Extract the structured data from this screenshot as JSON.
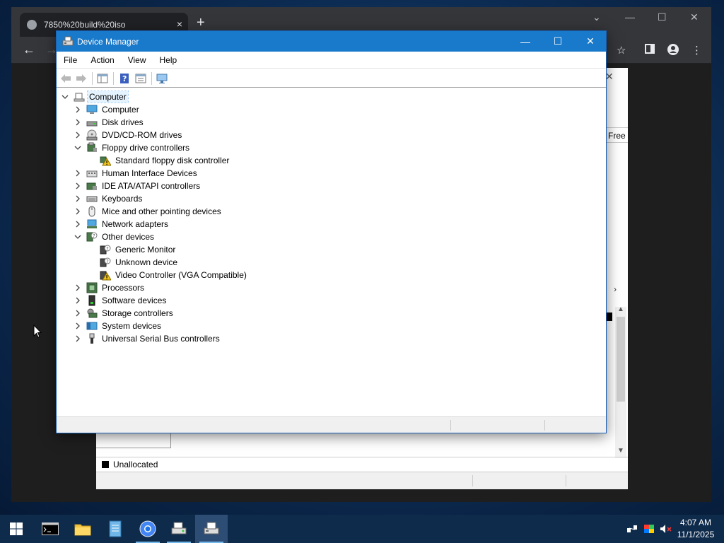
{
  "browser": {
    "tab_title": "7850%20build%20iso",
    "window_controls": [
      "minimize-icon",
      "maximize-icon",
      "close-icon"
    ]
  },
  "disk_management": {
    "column_header": "Free",
    "legend_label": "Unallocated",
    "legend_color": "#000000"
  },
  "device_manager": {
    "title": "Device Manager",
    "menu": [
      "File",
      "Action",
      "View",
      "Help"
    ],
    "toolbar": [
      "back-icon",
      "forward-icon",
      "show-hide-console-tree-icon",
      "help-icon",
      "properties-icon",
      "scan-hardware-icon"
    ],
    "root": "Computer",
    "categories": [
      {
        "label": "Computer",
        "icon": "computer-icon",
        "expanded": false
      },
      {
        "label": "Disk drives",
        "icon": "disk-drive-icon",
        "expanded": false
      },
      {
        "label": "DVD/CD-ROM drives",
        "icon": "dvd-drive-icon",
        "expanded": false
      },
      {
        "label": "Floppy drive controllers",
        "icon": "floppy-controller-icon",
        "expanded": true,
        "children": [
          {
            "label": "Standard floppy disk controller",
            "icon": "warning-device-icon"
          }
        ]
      },
      {
        "label": "Human Interface Devices",
        "icon": "hid-icon",
        "expanded": false
      },
      {
        "label": "IDE ATA/ATAPI controllers",
        "icon": "ide-controller-icon",
        "expanded": false
      },
      {
        "label": "Keyboards",
        "icon": "keyboard-icon",
        "expanded": false
      },
      {
        "label": "Mice and other pointing devices",
        "icon": "mouse-icon",
        "expanded": false
      },
      {
        "label": "Network adapters",
        "icon": "network-adapter-icon",
        "expanded": false
      },
      {
        "label": "Other devices",
        "icon": "unknown-device-icon",
        "expanded": true,
        "children": [
          {
            "label": "Generic Monitor",
            "icon": "unknown-device-icon"
          },
          {
            "label": "Unknown device",
            "icon": "unknown-device-icon"
          },
          {
            "label": "Video Controller (VGA Compatible)",
            "icon": "warning-device-icon"
          }
        ]
      },
      {
        "label": "Processors",
        "icon": "processor-icon",
        "expanded": false
      },
      {
        "label": "Software devices",
        "icon": "software-device-icon",
        "expanded": false
      },
      {
        "label": "Storage controllers",
        "icon": "storage-controller-icon",
        "expanded": false
      },
      {
        "label": "System devices",
        "icon": "system-device-icon",
        "expanded": false
      },
      {
        "label": "Universal Serial Bus controllers",
        "icon": "usb-icon",
        "expanded": false
      }
    ]
  },
  "taskbar": {
    "apps": [
      "start-icon",
      "terminal-icon",
      "file-explorer-icon",
      "notepad-icon",
      "chrome-icon",
      "disk-management-icon",
      "device-manager-icon"
    ],
    "active_app": "device-manager-icon",
    "tray": [
      "network-icon",
      "color-icon",
      "volume-muted-icon"
    ],
    "time": "4:07 AM",
    "date": "11/1/2025"
  },
  "colors": {
    "titlebar": "#1979ca",
    "taskbar": "#0f2b4c",
    "selection": "#e5f3ff",
    "warning": "#f2c318"
  }
}
